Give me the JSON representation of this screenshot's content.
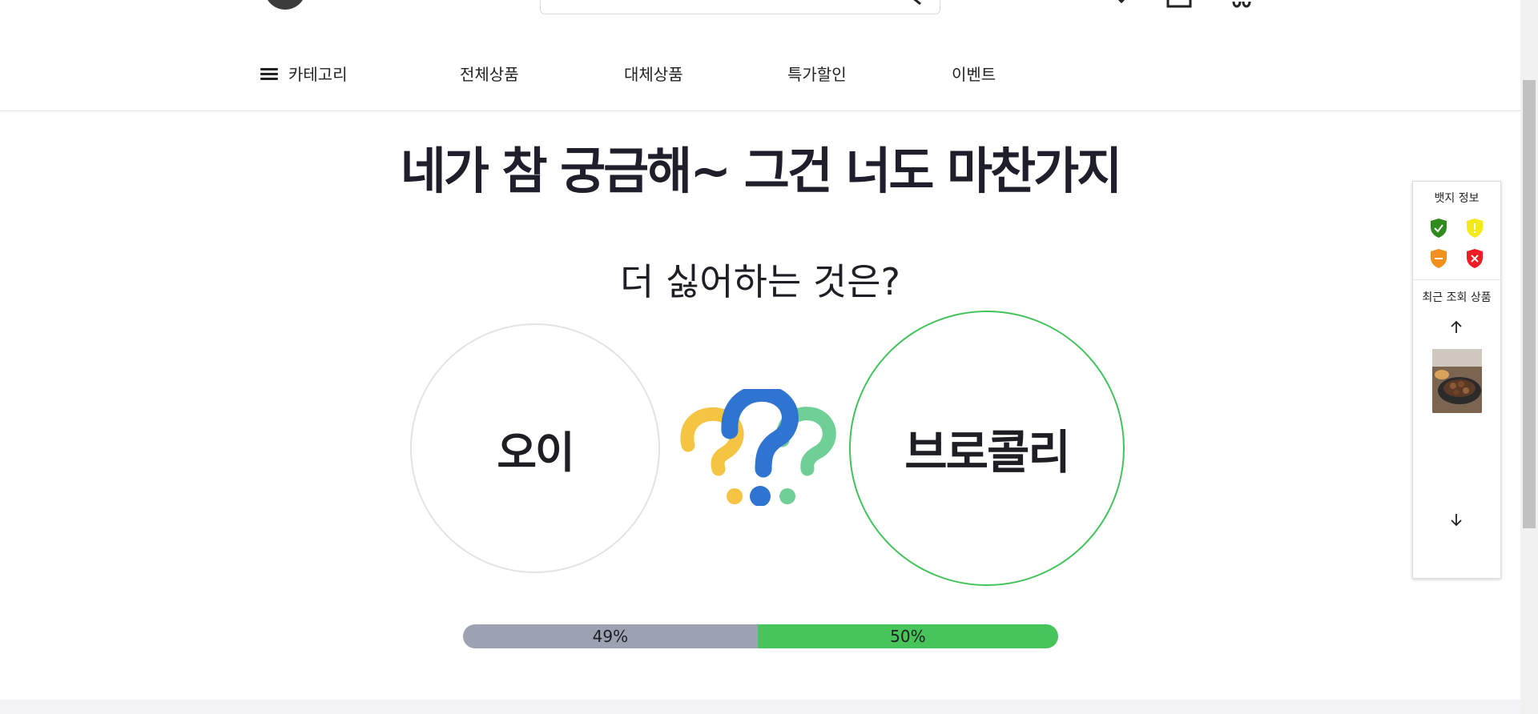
{
  "nav": {
    "category_label": "카테고리",
    "items": [
      {
        "label": "전체상품"
      },
      {
        "label": "대체상품"
      },
      {
        "label": "특가할인"
      },
      {
        "label": "이벤트"
      }
    ]
  },
  "main": {
    "title": "네가 참 궁금해~ 그건 너도 마찬가지",
    "question": "더 싫어하는 것은?",
    "options": [
      {
        "label": "오이",
        "percent_text": "49%",
        "percent": 49
      },
      {
        "label": "브로콜리",
        "percent_text": "50%",
        "percent": 50
      }
    ]
  },
  "side": {
    "badge_title": "뱃지 정보",
    "badges": [
      "green-check-shield-icon",
      "yellow-exclamation-shield-icon",
      "orange-minus-shield-icon",
      "red-x-shield-icon"
    ],
    "recent_title": "최근 조회 상품"
  },
  "colors": {
    "accent_green": "#47c55b",
    "progress_gray": "#9ca2b1",
    "selected_border": "#41c25a"
  }
}
